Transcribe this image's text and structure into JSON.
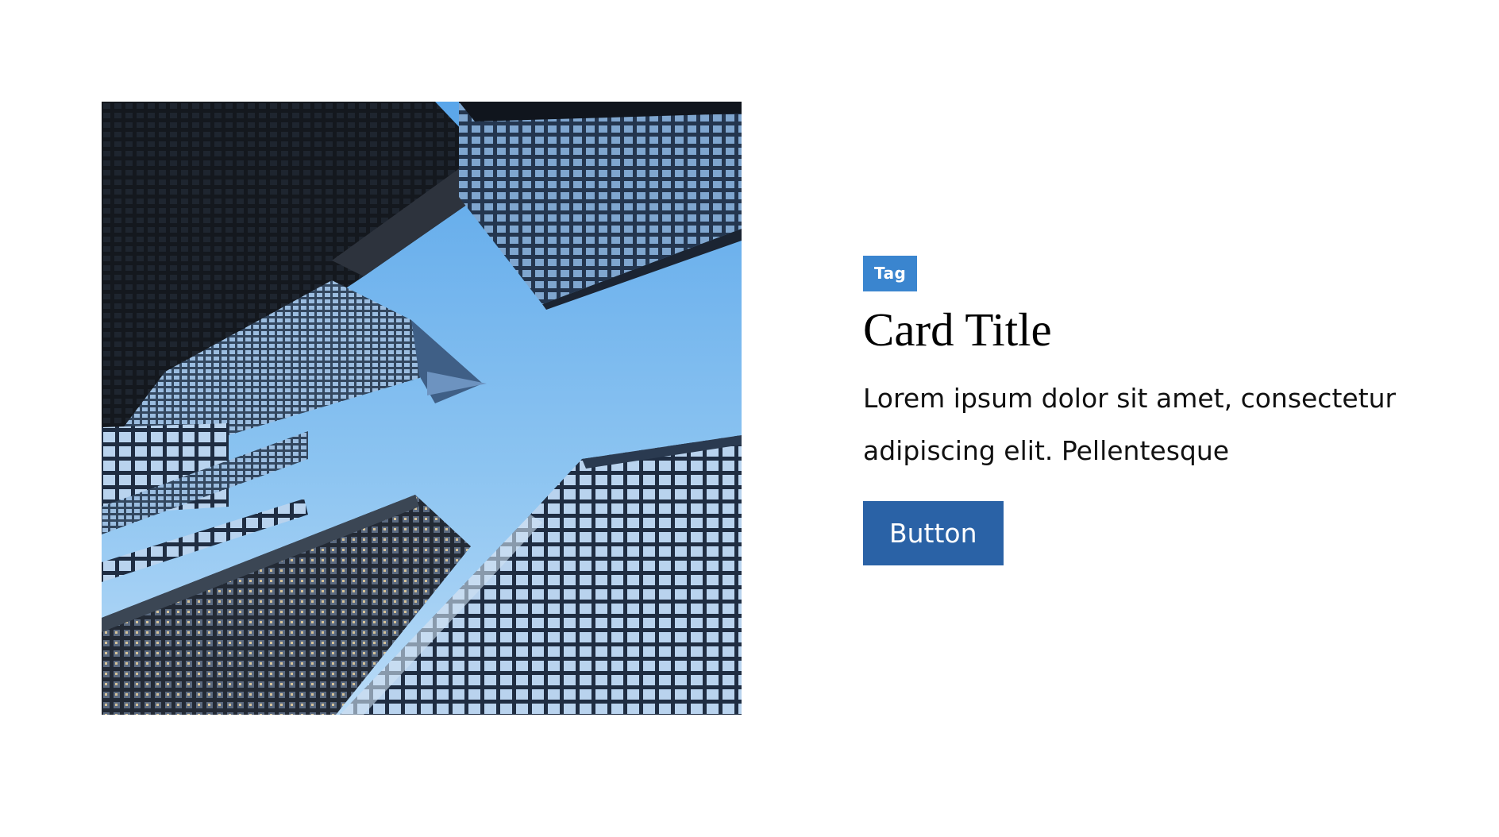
{
  "card": {
    "image_alt": "Upward view of skyscrapers against a blue sky",
    "tag_label": "Tag",
    "title": "Card Title",
    "description": "Lorem ipsum dolor sit amet, consectetur adipiscing elit. Pellentesque",
    "button_label": "Button"
  },
  "colors": {
    "tag_bg": "#3a85cf",
    "button_bg": "#2a62a6",
    "text": "#000000",
    "sky": "#79b7ee"
  }
}
